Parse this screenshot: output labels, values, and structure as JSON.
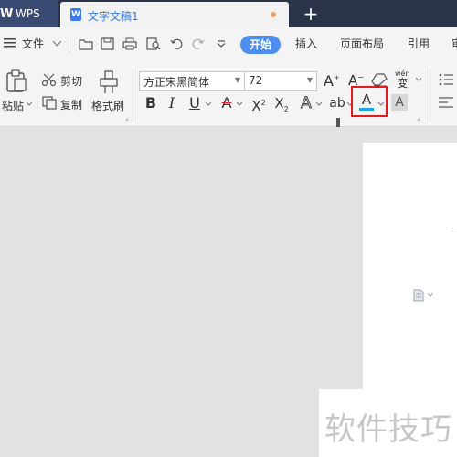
{
  "tabs": {
    "app_label": "WPS",
    "app_logo": "W",
    "document_title": "文字文稿1",
    "document_icon": "W",
    "new_tab": "+"
  },
  "menu": {
    "file_label": "文件",
    "ribbon_tabs": [
      "开始",
      "插入",
      "页面布局",
      "引用",
      "审"
    ],
    "active_tab": "开始"
  },
  "ribbon": {
    "paste_label": "粘贴",
    "cut_label": "剪切",
    "copy_label": "复制",
    "format_painter_label": "格式刷",
    "font_name": "方正宋黑简体",
    "font_size": "72",
    "pinyin_label": "wén",
    "pinyin_char": "变"
  },
  "watermark": {
    "text": "软件技巧"
  },
  "colors": {
    "tab_bar": "#2b3348",
    "accent_blue": "#4d8ef0",
    "highlight_red": "#e01c1c",
    "font_color_underline": "#1aa3e8"
  }
}
